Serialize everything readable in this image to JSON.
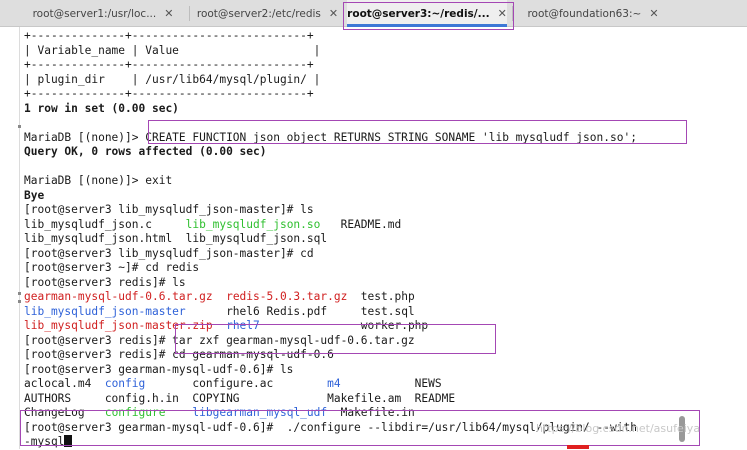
{
  "tabs": [
    {
      "label": "root@server1:/usr/loc...",
      "close": "✕"
    },
    {
      "label": "root@server2:/etc/redis",
      "close": "✕"
    },
    {
      "label": "root@server3:~/redis/...",
      "close": "✕"
    },
    {
      "label": "root@foundation63:~",
      "close": "✕"
    }
  ],
  "terminal": {
    "lines": [
      [
        {
          "t": "+--------------+--------------------------+"
        }
      ],
      [
        {
          "t": "| Variable_name | Value                    |"
        }
      ],
      [
        {
          "t": "+--------------+--------------------------+"
        }
      ],
      [
        {
          "t": "| plugin_dir    | /usr/lib64/mysql/plugin/ |"
        }
      ],
      [
        {
          "t": "+--------------+--------------------------+"
        }
      ],
      [
        {
          "t": "1 row in set (0.00 sec)",
          "c": "b"
        }
      ],
      [
        {
          "t": ""
        }
      ],
      [
        {
          "t": "MariaDB [(none)]> CREATE FUNCTION json_object RETURNS STRING SONAME 'lib_mysqludf_json.so';"
        }
      ],
      [
        {
          "t": "Query OK, 0 rows affected (0.00 sec)",
          "c": "b"
        }
      ],
      [
        {
          "t": ""
        }
      ],
      [
        {
          "t": "MariaDB [(none)]> exit"
        }
      ],
      [
        {
          "t": "Bye",
          "c": "b"
        }
      ],
      [
        {
          "t": "[root@server3 lib_mysqludf_json-master]# ls"
        }
      ],
      [
        {
          "t": "lib_mysqludf_json.c     "
        },
        {
          "t": "lib_mysqludf_json.so",
          "c": "g"
        },
        {
          "t": "   README.md"
        }
      ],
      [
        {
          "t": "lib_mysqludf_json.html  lib_mysqludf_json.sql"
        }
      ],
      [
        {
          "t": "[root@server3 lib_mysqludf_json-master]# cd"
        }
      ],
      [
        {
          "t": "[root@server3 ~]# cd redis"
        }
      ],
      [
        {
          "t": "[root@server3 redis]# ls"
        }
      ],
      [
        {
          "t": "gearman-mysql-udf-0.6.tar.gz",
          "c": "r"
        },
        {
          "t": "  "
        },
        {
          "t": "redis-5.0.3.tar.gz",
          "c": "r"
        },
        {
          "t": "  test.php"
        }
      ],
      [
        {
          "t": "lib_mysqludf_json-master",
          "c": "bl"
        },
        {
          "t": "      rhel6 Redis.pdf     test.sql"
        }
      ],
      [
        {
          "t": "lib_mysqludf_json-master.zip",
          "c": "r"
        },
        {
          "t": "  "
        },
        {
          "t": "rhel7",
          "c": "bl"
        },
        {
          "t": "               worker.php"
        }
      ],
      [
        {
          "t": "[root@server3 redis]# tar zxf gearman-mysql-udf-0.6.tar.gz"
        }
      ],
      [
        {
          "t": "[root@server3 redis]# cd gearman-mysql-udf-0.6"
        }
      ],
      [
        {
          "t": "[root@server3 gearman-mysql-udf-0.6]# ls"
        }
      ],
      [
        {
          "t": "aclocal.m4  "
        },
        {
          "t": "config",
          "c": "bl"
        },
        {
          "t": "       configure.ac        "
        },
        {
          "t": "m4",
          "c": "bl"
        },
        {
          "t": "           NEWS"
        }
      ],
      [
        {
          "t": "AUTHORS     config.h.in  COPYING             Makefile.am  README"
        }
      ],
      [
        {
          "t": "ChangeLog   "
        },
        {
          "t": "configure",
          "c": "g"
        },
        {
          "t": "    "
        },
        {
          "t": "libgearman_mysql_udf",
          "c": "bl"
        },
        {
          "t": "  Makefile.in"
        }
      ],
      [
        {
          "t": "[root@server3 gearman-mysql-udf-0.6]#  ./configure --libdir=/usr/lib64/mysql/plugin/ --with"
        }
      ],
      [
        {
          "t": "-mysql"
        }
      ]
    ]
  },
  "watermark": "https://blog.csdn.net/asufeiya"
}
